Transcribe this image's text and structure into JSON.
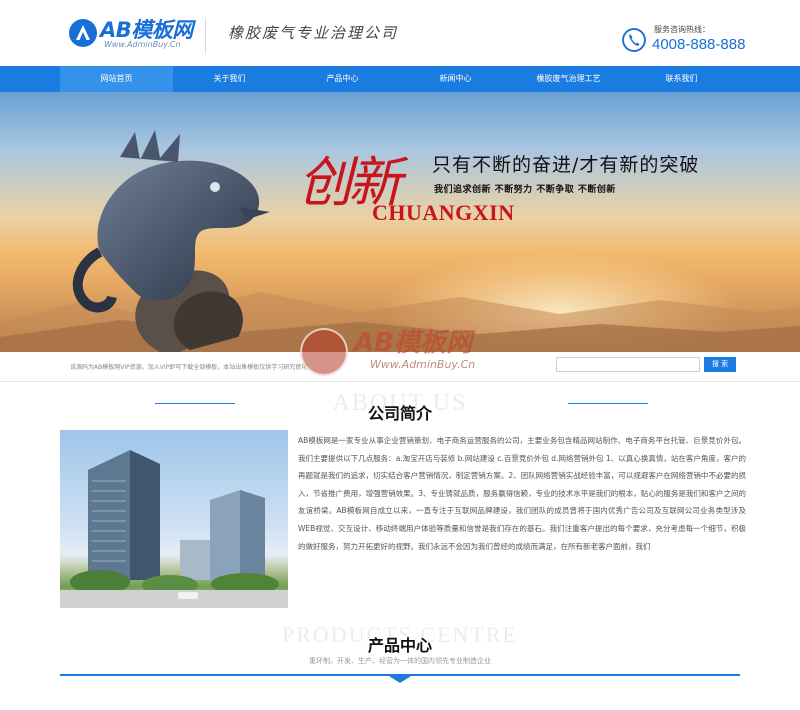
{
  "header": {
    "logo_text": "AB模板网",
    "logo_sub": "Www.AdminBuy.Cn",
    "slogan": "橡胶废气专业治理公司",
    "hotline_label": "服务咨询热线：",
    "hotline_number": "4008-888-888"
  },
  "nav": {
    "items": [
      {
        "label": "网站首页",
        "active": true
      },
      {
        "label": "关于我们"
      },
      {
        "label": "产品中心"
      },
      {
        "label": "新闻中心"
      },
      {
        "label": "橡胶废气治理工艺"
      },
      {
        "label": "联系我们"
      }
    ]
  },
  "banner": {
    "brush_text": "创新",
    "headline": "只有不断的奋进/才有新的突破",
    "subline": "我们追求创新  不断努力  不断争取  不断创新",
    "english": "CHUANGXIN"
  },
  "infobar": {
    "notice": "该源码为AB模板网VIP资源，加入VIP即可下载全部模板，本站出售模板仅供学习研究使用",
    "search_placeholder": "",
    "search_button": "搜 索"
  },
  "watermark": {
    "text": "AB模板网",
    "sub": "Www.AdminBuy.Cn"
  },
  "about": {
    "bg_en": "ABOUT US",
    "title": "公司简介",
    "text": "AB模板网是一家专业从事企业营销策划、电子商务运营服务的公司，主要业务包含精品网站制作、电子商务平台托管、巨景竞价外包。我们主要提供以下几点服务：a.淘宝开店与装修 b.网站建设 c.百景竞价外包 d.网络营销外包 1、以真心换真情，站在客户角度，客户的再题就是我们的追求，切实结合客户营销情况，制定营销方案。2、团队网络营销实战经验丰富，可以规避客户在网络营销中不必要的损入，节省推广费用，增强营销效果。3、专业铸就品质，服务赢得信赖，专业的技术水平是我们的根本，贴心的服务是我们和客户之间的友谊桥梁。AB模板网自成立以来，一直专注于互联网品牌建设，我们团队的成员曾将于国内优秀广告公司及互联网公司业务类型涉及WEB视觉、交互设计、移动终端用户体验等质量和信誉是我们存在的基石。我们注重客户提出的每个要求，充分考虑每一个细节，积极的做好服务，努力开拓更好的视野。我们永远不会因为我们曾经的成绩而满足，在所有新老客户面前，我们"
  },
  "products": {
    "bg_en": "PRODUCTS CENTRE",
    "title": "产品中心",
    "subtitle": "重环制、开发、生产、经营为一体的国内领先专业制造企业"
  },
  "colors": {
    "brand_blue": "#1a7ce0",
    "banner_red": "#c8141b"
  }
}
